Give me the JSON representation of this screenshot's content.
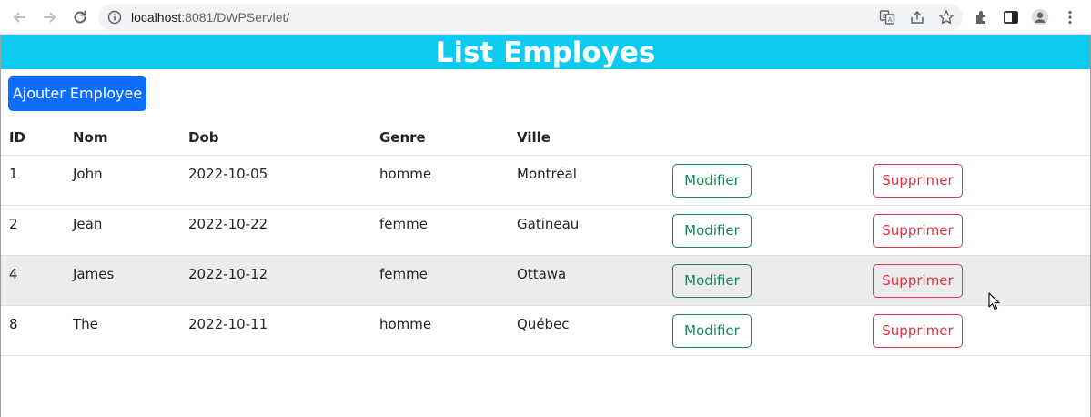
{
  "browser": {
    "url_host": "localhost",
    "url_path": ":8081/DWPServlet/"
  },
  "page": {
    "title": "List Employes",
    "add_button_label": "Ajouter Employee"
  },
  "table": {
    "headers": [
      "ID",
      "Nom",
      "Dob",
      "Genre",
      "Ville"
    ],
    "rows": [
      {
        "id": "1",
        "nom": "John",
        "dob": "2022-10-05",
        "genre": "homme",
        "ville": "Montréal",
        "edit": "Modifier",
        "delete": "Supprimer"
      },
      {
        "id": "2",
        "nom": "Jean",
        "dob": "2022-10-22",
        "genre": "femme",
        "ville": "Gatineau",
        "edit": "Modifier",
        "delete": "Supprimer"
      },
      {
        "id": "4",
        "nom": "James",
        "dob": "2022-10-12",
        "genre": "femme",
        "ville": "Ottawa",
        "edit": "Modifier",
        "delete": "Supprimer"
      },
      {
        "id": "8",
        "nom": "The",
        "dob": "2022-10-11",
        "genre": "homme",
        "ville": "Québec",
        "edit": "Modifier",
        "delete": "Supprimer"
      }
    ]
  },
  "colors": {
    "title_bar": "#0dcaf0",
    "primary": "#0d6efd",
    "success": "#198754",
    "danger": "#dc3545",
    "hover_row": "#ececec"
  },
  "icons": {
    "back": "arrow-left-icon",
    "forward": "arrow-right-icon",
    "reload": "reload-icon",
    "info": "info-icon",
    "translate": "translate-icon",
    "share": "share-icon",
    "bookmark": "star-icon",
    "extensions": "puzzle-icon",
    "side_panel": "side-panel-icon",
    "profile": "profile-icon",
    "menu": "kebab-menu-icon"
  }
}
